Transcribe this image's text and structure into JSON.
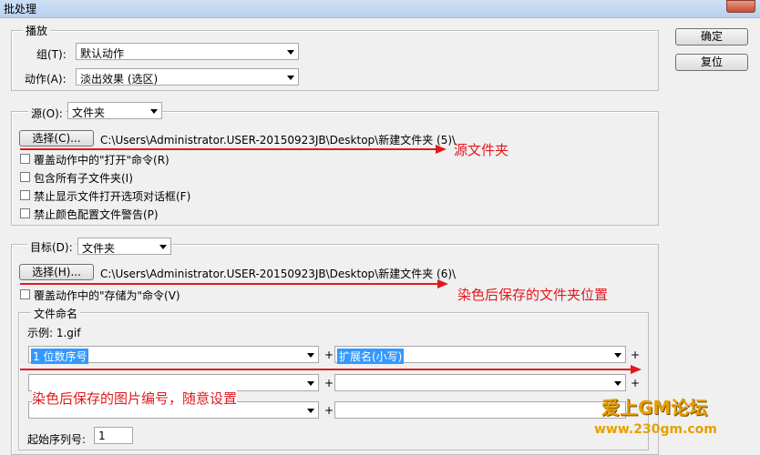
{
  "window": {
    "title": "批处理"
  },
  "buttons": {
    "ok": "确定",
    "reset": "复位"
  },
  "play": {
    "legend": "播放",
    "group_label": "组(T):",
    "group_value": "默认动作",
    "action_label": "动作(A):",
    "action_value": "淡出效果 (选区)"
  },
  "source": {
    "label": "源(O):",
    "value": "文件夹",
    "choose": "选择(C)...",
    "path": "C:\\Users\\Administrator.USER-20150923JB\\Desktop\\新建文件夹 (5)\\",
    "options": [
      "覆盖动作中的\"打开\"命令(R)",
      "包含所有子文件夹(I)",
      "禁止显示文件打开选项对话框(F)",
      "禁止颜色配置文件警告(P)"
    ]
  },
  "dest": {
    "label": "目标(D):",
    "value": "文件夹",
    "choose": "选择(H)...",
    "path": "C:\\Users\\Administrator.USER-20150923JB\\Desktop\\新建文件夹 (6)\\",
    "override": "覆盖动作中的\"存储为\"命令(V)"
  },
  "naming": {
    "legend": "文件命名",
    "example": "示例: 1.gif",
    "field1": "1 位数序号",
    "field2": "扩展名(小写)",
    "plus": "+",
    "start_label": "起始序列号:",
    "start_value": "1"
  },
  "annotations": {
    "a1": "源文件夹",
    "a2": "染色后保存的文件夹位置",
    "a3": "染色后保存的图片编号，随意设置"
  },
  "watermark": {
    "line1": "爱上GM论坛",
    "line2": "www.230gm.com"
  },
  "colors": {
    "annotation": "#e0191f",
    "selection": "#3399ff"
  }
}
